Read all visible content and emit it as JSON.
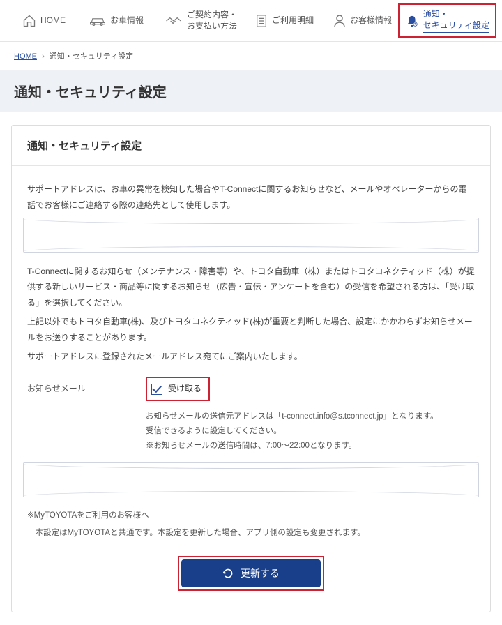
{
  "nav": {
    "home": "HOME",
    "car_info": "お車情報",
    "contract": "ご契約内容・\nお支払い方法",
    "usage": "ご利用明細",
    "customer": "お客様情報",
    "notify": "通知・\nセキュリティ設定"
  },
  "breadcrumb": {
    "home": "HOME",
    "current": "通知・セキュリティ設定"
  },
  "page_title": "通知・セキュリティ設定",
  "card": {
    "title": "通知・セキュリティ設定",
    "intro": "サポートアドレスは、お車の異常を検知した場合やT-Connectに関するお知らせなど、メールやオペレーターからの電話でお客様にご連絡する際の連絡先として使用します。",
    "para1": "T-Connectに関するお知らせ（メンテナンス・障害等）や、トヨタ自動車（株）またはトヨタコネクティッド（株）が提供する新しいサービス・商品等に関するお知らせ（広告・宣伝・アンケートを含む）の受信を希望される方は、「受け取る」を選択してください。",
    "para2": "上記以外でもトヨタ自動車(株)、及びトヨタコネクティッド(株)が重要と判断した場合、設定にかかわらずお知らせメールをお送りすることがあります。",
    "para3": "サポートアドレスに登録されたメールアドレス宛てにご案内いたします。",
    "field_label": "お知らせメール",
    "checkbox_label": "受け取る",
    "note1": "お知らせメールの送信元アドレスは「t-connect.info@s.tconnect.jp」となります。",
    "note2": "受信できるように設定してください。",
    "note3": "※お知らせメールの送信時間は、7:00～22:00となります。",
    "foot1": "※MyTOYOTAをご利用のお客様へ",
    "foot2": "　本設定はMyTOYOTAと共通です。本設定を更新した場合、アプリ側の設定も変更されます。",
    "button": "更新する"
  }
}
